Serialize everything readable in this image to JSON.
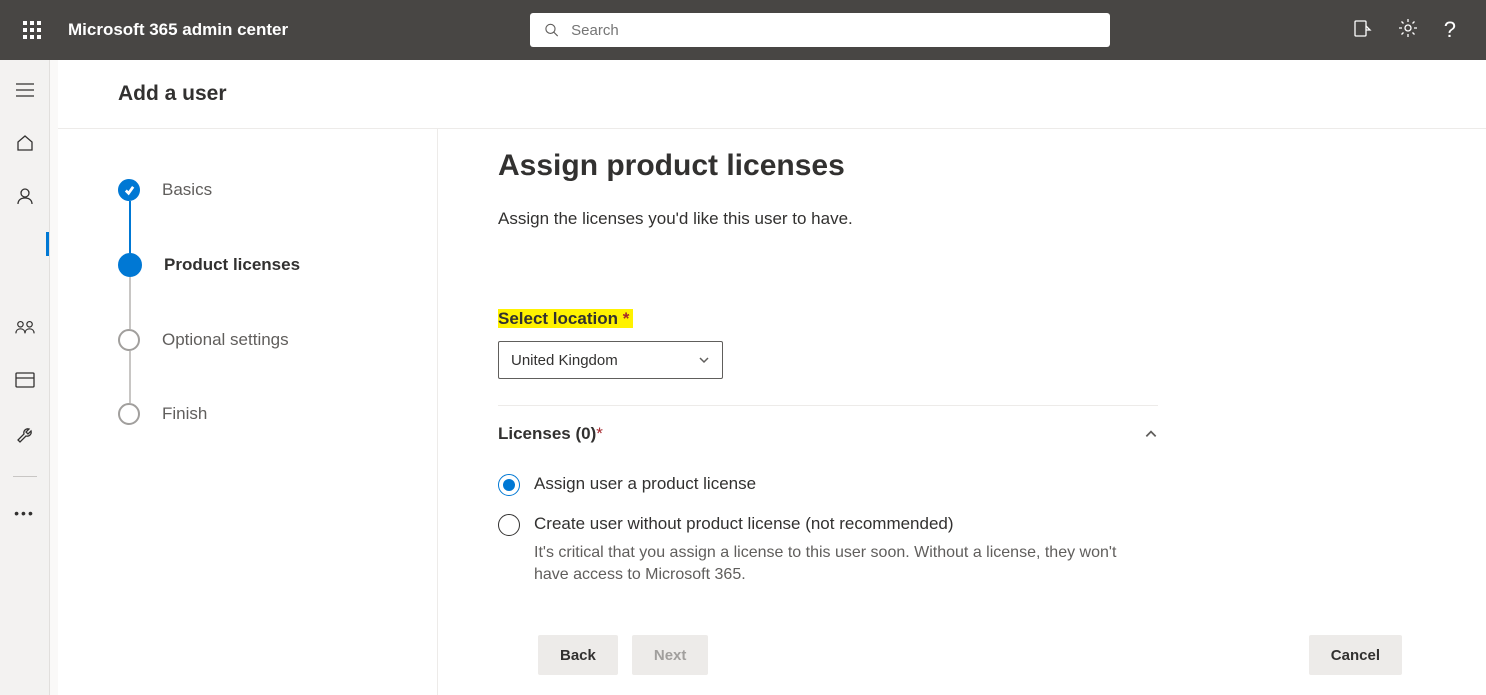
{
  "header": {
    "app_title": "Microsoft 365 admin center",
    "search_placeholder": "Search"
  },
  "leftrail": {
    "active_index": 2
  },
  "panel": {
    "title": "Add a user"
  },
  "wizard": {
    "steps": [
      {
        "label": "Basics",
        "state": "done"
      },
      {
        "label": "Product licenses",
        "state": "current"
      },
      {
        "label": "Optional settings",
        "state": "pending"
      },
      {
        "label": "Finish",
        "state": "pending"
      }
    ]
  },
  "content": {
    "heading": "Assign product licenses",
    "description": "Assign the licenses you'd like this user to have.",
    "location_label": "Select location",
    "location_required": "*",
    "location_value": "United Kingdom",
    "licenses_label": "Licenses (0)",
    "licenses_required": "*",
    "radio_assign_label": "Assign user a product license",
    "radio_nolicense_label": "Create user without product license (not recommended)",
    "radio_nolicense_hint": "It's critical that you assign a license to this user soon. Without a license, they won't have access to Microsoft 365."
  },
  "footer": {
    "back": "Back",
    "next": "Next",
    "cancel": "Cancel"
  }
}
